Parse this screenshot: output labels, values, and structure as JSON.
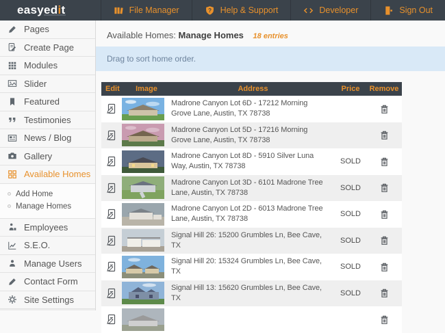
{
  "brand": {
    "left": "easyed",
    "accent": "i",
    "right": "t"
  },
  "colors": {
    "accent": "#e8912c",
    "dark": "#3b434b",
    "notice_bg": "#d9e9f7",
    "notice_text": "#6d839d"
  },
  "topbar": {
    "items": [
      {
        "label": "File Manager",
        "icon": "file-manager-icon"
      },
      {
        "label": "Help & Support",
        "icon": "help-icon"
      },
      {
        "label": "Developer",
        "icon": "developer-icon"
      },
      {
        "label": "Sign Out",
        "icon": "sign-out-icon"
      }
    ]
  },
  "sidebar": {
    "items": [
      {
        "label": "Pages",
        "icon": "pencil-icon"
      },
      {
        "label": "Create Page",
        "icon": "create-page-icon"
      },
      {
        "label": "Modules",
        "icon": "modules-icon"
      },
      {
        "label": "Slider",
        "icon": "slider-image-icon"
      },
      {
        "label": "Featured",
        "icon": "bookmark-icon"
      },
      {
        "label": "Testimonies",
        "icon": "quotes-icon"
      },
      {
        "label": "News / Blog",
        "icon": "newspaper-icon"
      },
      {
        "label": "Gallery",
        "icon": "camera-icon"
      },
      {
        "label": "Available Homes",
        "icon": "grid-icon",
        "active": true
      },
      {
        "label": "Employees",
        "icon": "employee-icon"
      },
      {
        "label": "S.E.O.",
        "icon": "chart-icon"
      },
      {
        "label": "Manage Users",
        "icon": "user-icon"
      },
      {
        "label": "Contact Form",
        "icon": "pencil-icon"
      },
      {
        "label": "Site Settings",
        "icon": "gear-icon"
      }
    ],
    "submenu": [
      {
        "label": "Add Home"
      },
      {
        "label": "Manage Homes"
      }
    ]
  },
  "header": {
    "title_prefix": "Available Homes:",
    "title_bold": "Manage Homes",
    "entries": "18 entries"
  },
  "notice": {
    "text": "Drag to sort home order."
  },
  "table": {
    "columns": [
      "Edit",
      "Image",
      "Address",
      "Price",
      "Remove"
    ],
    "rows": [
      {
        "address": "Madrone Canyon Lot 6D - 17212 Morning Grove Lane, Austin, TX 78738",
        "price": "",
        "thumb": {
          "sky": "#79b2e2",
          "house": "#cec3a9",
          "roof": "#8a7f6b",
          "ground": "#699e50"
        }
      },
      {
        "address": "Madrone Canyon Lot 5D - 17216 Morning Grove Lane, Austin, TX 78738",
        "price": "",
        "thumb": {
          "sky": "#c99bb0",
          "house": "#bcab8d",
          "roof": "#74654f",
          "ground": "#5d7a4a"
        }
      },
      {
        "address": "Madrone Canyon Lot 8D - 5910 Silver Luna Way, Austin, TX 78738",
        "price": "SOLD",
        "thumb": {
          "sky": "#5c6c84",
          "house": "#d9c59b",
          "roof": "#494a53",
          "ground": "#3f5a3a"
        }
      },
      {
        "address": "Madrone Canyon Lot 3D - 6101 Madrone Tree Lane, Austin, TX 78738",
        "price": "SOLD",
        "thumb": {
          "sky": "#8fae7a",
          "house": "#d0d4d7",
          "roof": "#6b7280",
          "ground": "#7fa35f"
        }
      },
      {
        "address": "Madrone Canyon Lot 2D - 6013 Madrone Tree Lane, Austin, TX 78738",
        "price": "SOLD",
        "thumb": {
          "sky": "#9aa6ad",
          "house": "#e4e1da",
          "roof": "#7b8288",
          "ground": "#b9b4a8"
        }
      },
      {
        "address": "Signal Hill 26: 15200 Grumbles Ln, Bee Cave, TX",
        "price": "SOLD",
        "thumb": {
          "sky": "#c5ced5",
          "house": "#f0efe9",
          "roof": "#8e8e8e",
          "ground": "#a8a195"
        }
      },
      {
        "address": "Signal Hill 20: 15324 Grumbles Ln, Bee Cave, TX",
        "price": "SOLD",
        "thumb": {
          "sky": "#7fb2dd",
          "house": "#d7caa9",
          "roof": "#6e675c",
          "ground": "#8c8f7a"
        }
      },
      {
        "address": "Signal Hill 13: 15620 Grumbles Ln, Bee Cave, TX",
        "price": "SOLD",
        "thumb": {
          "sky": "#8fb4d8",
          "house": "#7e8fa6",
          "roof": "#55617a",
          "ground": "#5d8a4a"
        }
      },
      {
        "address": "",
        "price": "",
        "thumb": {
          "sky": "#aeb6bd",
          "house": "#cfcfcf",
          "roof": "#9a9a9a",
          "ground": "#9aa08f"
        }
      }
    ]
  }
}
